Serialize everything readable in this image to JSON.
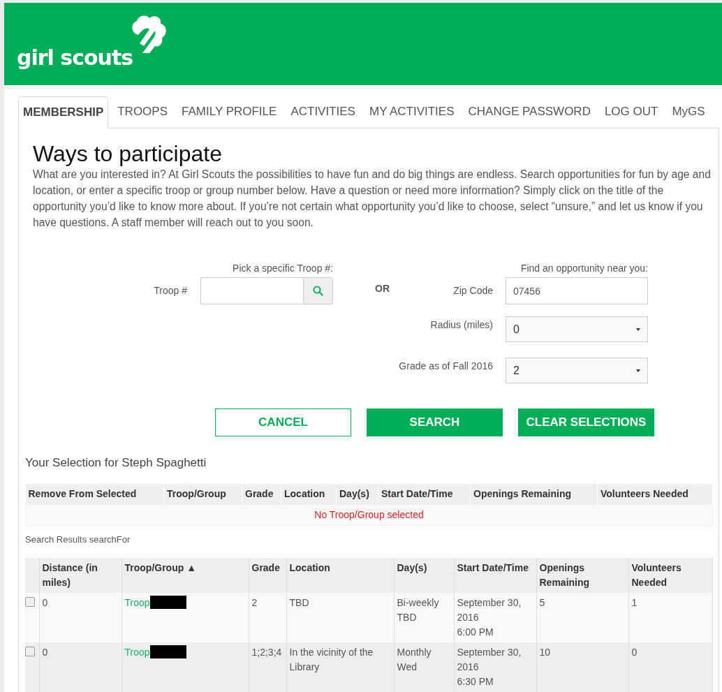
{
  "logo": {
    "text": "girl scouts"
  },
  "tabs": [
    {
      "label": "MEMBERSHIP",
      "selected": true
    },
    {
      "label": "TROOPS",
      "selected": false
    },
    {
      "label": "FAMILY PROFILE",
      "selected": false
    },
    {
      "label": "ACTIVITIES",
      "selected": false
    },
    {
      "label": "MY ACTIVITIES",
      "selected": false
    },
    {
      "label": "CHANGE PASSWORD",
      "selected": false
    },
    {
      "label": "LOG OUT",
      "selected": false
    },
    {
      "label": "MyGS",
      "selected": false
    }
  ],
  "intro": {
    "title": "Ways to participate",
    "text": "What are you interested in? At Girl Scouts the possibilities to have fun and do big things are endless. Search opportunities for fun by age and location, or enter a specific troop or group number below. Have a question or need more information? Simply click on the title of the opportunity you’d like to know more about. If you’re not certain what opportunity you’d like to choose, select “unsure,” and let us know if you have questions. A staff member will reach out to you soon."
  },
  "troop_search": {
    "caption": "Pick a specific Troop #:",
    "label": "Troop #"
  },
  "separator": "OR",
  "location_search": {
    "caption": "Find an opportunity near you:",
    "fields": [
      {
        "kind": "text",
        "label": "Zip Code",
        "value": "07456"
      },
      {
        "kind": "select",
        "label": "Radius (miles)",
        "value": "0"
      },
      {
        "kind": "select",
        "label": "Grade as of Fall 2016",
        "value": "2"
      }
    ]
  },
  "buttons": [
    {
      "label": "CANCEL",
      "kind": "outline"
    },
    {
      "label": "SEARCH",
      "kind": "primary"
    },
    {
      "label": "CLEAR SELECTIONS",
      "kind": "primary"
    }
  ],
  "selection": {
    "title": "Your Selection for Steph Spaghetti",
    "columns": [
      "Remove From Selected",
      "Troop/Group",
      "Grade",
      "Location",
      "Day(s)",
      "Start Date/Time",
      "Openings Remaining",
      "Volunteers Needed"
    ],
    "empty_message": "No Troop/Group selected"
  },
  "results": {
    "title": "Search Results searchFor",
    "columns": [
      "Distance (in miles)",
      "Troop/Group ▲",
      "Grade",
      "Location",
      "Day(s)",
      "Start Date/Time",
      "Openings Remaining",
      "Volunteers Needed"
    ],
    "rows": [
      {
        "checked": false,
        "cells": [
          "0",
          "Troop",
          "2",
          "TBD",
          "Bi-weekly TBD",
          "September 30, 2016\n6:00 PM",
          "5",
          "1"
        ]
      },
      {
        "checked": false,
        "cells": [
          "0",
          "Troop",
          "1;2;3;4",
          "In the vicinity of the Library",
          "Monthly Wed",
          "September 30, 2016\n6:30 PM",
          "10",
          "0"
        ]
      }
    ]
  }
}
